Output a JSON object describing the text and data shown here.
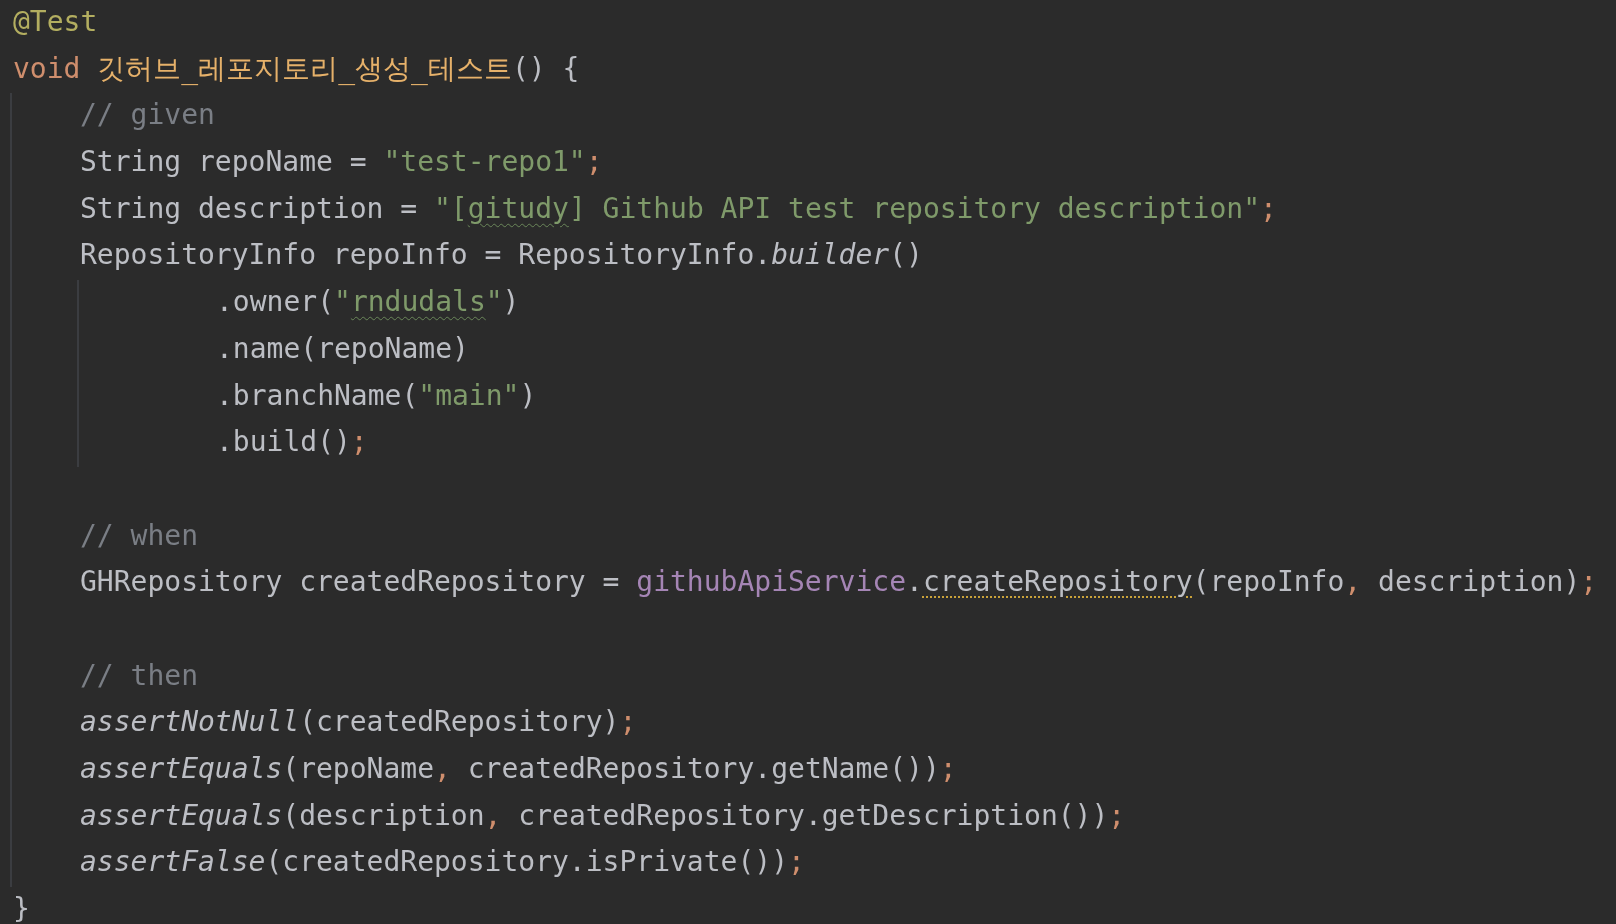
{
  "editor": {
    "lines": [
      {
        "kind": "code",
        "tokens": [
          {
            "text": "@Test",
            "kind": "annotation"
          }
        ]
      },
      {
        "kind": "code",
        "tokens": [
          {
            "text": "void ",
            "kind": "keyword"
          },
          {
            "text": "깃허브_레포지토리_생성_테스트",
            "kind": "method-decl"
          },
          {
            "text": "() {",
            "kind": "plain"
          }
        ],
        "continuation": false,
        "children": [
          {
            "kind": "code",
            "tokens": [
              {
                "text": "// given",
                "kind": "comment"
              }
            ]
          },
          {
            "kind": "code",
            "tokens": [
              {
                "text": "String repoName = ",
                "kind": "plain"
              },
              {
                "text": "\"test-repo1\"",
                "kind": "string"
              },
              {
                "text": ";",
                "kind": "punct"
              }
            ]
          },
          {
            "kind": "code",
            "tokens": [
              {
                "text": "String description = ",
                "kind": "plain"
              },
              {
                "text": "\"[",
                "kind": "string"
              },
              {
                "text": "gitudy",
                "kind": "string",
                "typo": true
              },
              {
                "text": "] Github API test repository description\"",
                "kind": "string"
              },
              {
                "text": ";",
                "kind": "punct"
              }
            ]
          },
          {
            "kind": "code",
            "tokens": [
              {
                "text": "RepositoryInfo repoInfo = RepositoryInfo.",
                "kind": "plain"
              },
              {
                "text": "builder",
                "kind": "static"
              },
              {
                "text": "()",
                "kind": "plain"
              }
            ],
            "continuation": true,
            "children": [
              {
                "kind": "code",
                "tokens": [
                  {
                    "text": ".owner(",
                    "kind": "plain"
                  },
                  {
                    "text": "\"",
                    "kind": "string"
                  },
                  {
                    "text": "rndudals",
                    "kind": "string",
                    "typo": true
                  },
                  {
                    "text": "\"",
                    "kind": "string"
                  },
                  {
                    "text": ")",
                    "kind": "plain"
                  }
                ]
              },
              {
                "kind": "code",
                "tokens": [
                  {
                    "text": ".name(repoName)",
                    "kind": "plain"
                  }
                ]
              },
              {
                "kind": "code",
                "tokens": [
                  {
                    "text": ".branchName(",
                    "kind": "plain"
                  },
                  {
                    "text": "\"main\"",
                    "kind": "string"
                  },
                  {
                    "text": ")",
                    "kind": "plain"
                  }
                ]
              },
              {
                "kind": "code",
                "tokens": [
                  {
                    "text": ".build()",
                    "kind": "plain"
                  },
                  {
                    "text": ";",
                    "kind": "punct"
                  }
                ]
              }
            ]
          },
          {
            "kind": "blank"
          },
          {
            "kind": "code",
            "tokens": [
              {
                "text": "// when",
                "kind": "comment"
              }
            ]
          },
          {
            "kind": "code",
            "tokens": [
              {
                "text": "GHRepository createdRepository = ",
                "kind": "plain"
              },
              {
                "text": "githubApiService",
                "kind": "field"
              },
              {
                "text": ".",
                "kind": "plain"
              },
              {
                "text": "createRepository",
                "kind": "plain",
                "warning": true
              },
              {
                "text": "(repoInfo",
                "kind": "plain"
              },
              {
                "text": ",",
                "kind": "punct"
              },
              {
                "text": " description)",
                "kind": "plain"
              },
              {
                "text": ";",
                "kind": "punct"
              }
            ]
          },
          {
            "kind": "blank"
          },
          {
            "kind": "code",
            "tokens": [
              {
                "text": "// then",
                "kind": "comment"
              }
            ]
          },
          {
            "kind": "code",
            "tokens": [
              {
                "text": "assertNotNull",
                "kind": "static"
              },
              {
                "text": "(createdRepository)",
                "kind": "plain"
              },
              {
                "text": ";",
                "kind": "punct"
              }
            ]
          },
          {
            "kind": "code",
            "tokens": [
              {
                "text": "assertEquals",
                "kind": "static"
              },
              {
                "text": "(repoName",
                "kind": "plain"
              },
              {
                "text": ",",
                "kind": "punct"
              },
              {
                "text": " createdRepository.getName())",
                "kind": "plain"
              },
              {
                "text": ";",
                "kind": "punct"
              }
            ]
          },
          {
            "kind": "code",
            "tokens": [
              {
                "text": "assertEquals",
                "kind": "static"
              },
              {
                "text": "(description",
                "kind": "plain"
              },
              {
                "text": ",",
                "kind": "punct"
              },
              {
                "text": " createdRepository.getDescription())",
                "kind": "plain"
              },
              {
                "text": ";",
                "kind": "punct"
              }
            ]
          },
          {
            "kind": "code",
            "tokens": [
              {
                "text": "assertFalse",
                "kind": "static"
              },
              {
                "text": "(createdRepository.isPrivate())",
                "kind": "plain"
              },
              {
                "text": ";",
                "kind": "punct"
              }
            ]
          }
        ]
      },
      {
        "kind": "code",
        "tokens": [
          {
            "text": "}",
            "kind": "plain"
          }
        ]
      }
    ]
  }
}
